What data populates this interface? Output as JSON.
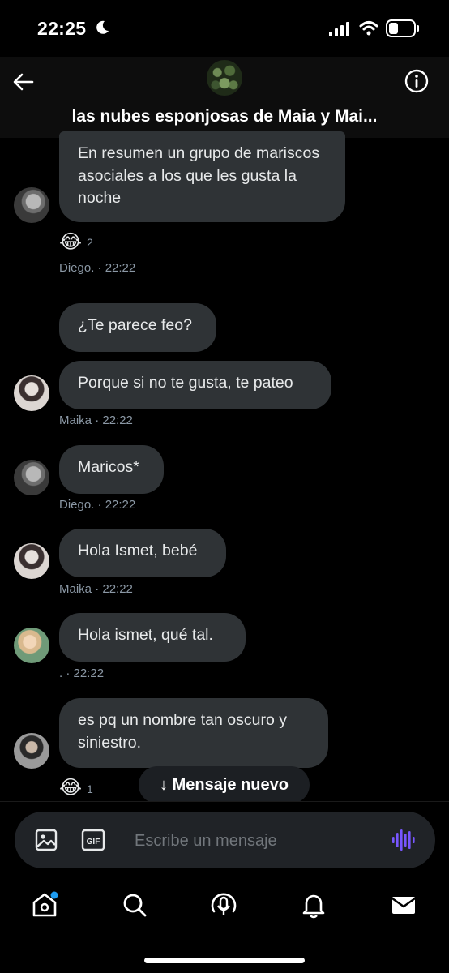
{
  "status_bar": {
    "time": "22:25"
  },
  "header": {
    "title": "las nubes esponjosas de Maia y Mai..."
  },
  "messages": [
    {
      "text": "En resumen un grupo de mariscos asociales a los que les gusta la noche",
      "reaction_emoji": "😂",
      "reaction_count": "2",
      "sender": "Diego.",
      "time": "· 22:22"
    },
    {
      "text": "¿Te parece feo?"
    },
    {
      "text": "Porque si no te gusta, te pateo",
      "sender": "Maika",
      "time": "· 22:22"
    },
    {
      "text": "Maricos*",
      "sender": "Diego.",
      "time": "· 22:22"
    },
    {
      "text": "Hola Ismet, bebé",
      "sender": "Maika",
      "time": "· 22:22"
    },
    {
      "text": "Hola ismet, qué tal.",
      "sender": ".",
      "time": "· 22:22"
    },
    {
      "text": "es pq un nombre tan oscuro y siniestro.",
      "reaction_emoji": "😂",
      "reaction_count": "1"
    }
  ],
  "new_message_pill": {
    "arrow": "↓",
    "label": "Mensaje nuevo"
  },
  "composer": {
    "placeholder": "Escribe un mensaje",
    "gif_label": "GIF"
  },
  "nav": {
    "items": [
      {
        "icon": "home-icon",
        "has_notification_dot": true
      },
      {
        "icon": "search-icon"
      },
      {
        "icon": "spaces-icon"
      },
      {
        "icon": "notifications-icon"
      },
      {
        "icon": "messages-icon"
      }
    ]
  },
  "colors": {
    "accent": "#1d9bf0",
    "bubble": "#2f3336",
    "voice": "#7856ff"
  }
}
